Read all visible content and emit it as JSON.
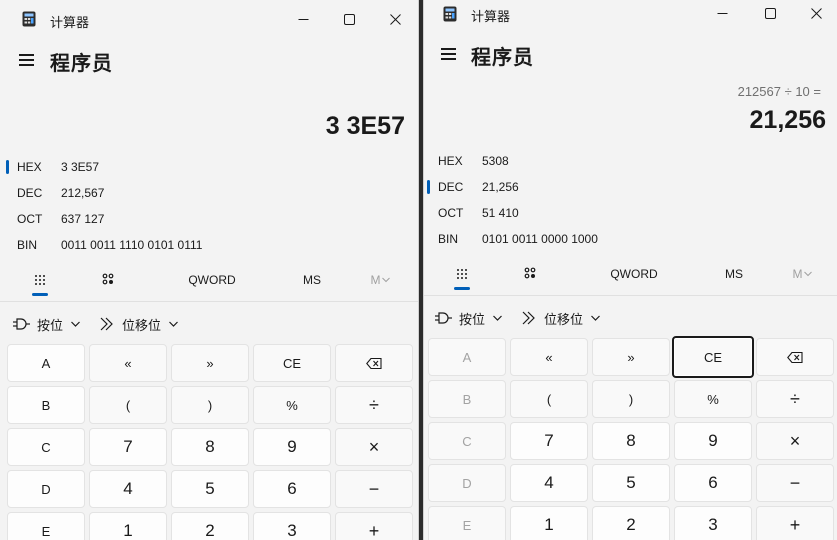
{
  "left": {
    "app_title": "计算器",
    "mode_title": "程序员",
    "display": "3 3E57",
    "radix": [
      {
        "label": "HEX",
        "value": "3 3E57"
      },
      {
        "label": "DEC",
        "value": "212,567"
      },
      {
        "label": "OCT",
        "value": "637 127"
      },
      {
        "label": "BIN",
        "value": "0011 0011 1110 0101 0111"
      }
    ],
    "tabs": {
      "word": "QWORD",
      "ms": "MS",
      "mplus": "M"
    },
    "options": {
      "bitwise": "按位",
      "bitshift": "位移位"
    },
    "keys": [
      [
        "A",
        "«",
        "»",
        "CE",
        "⌫"
      ],
      [
        "B",
        "(",
        ")",
        "%",
        "÷"
      ],
      [
        "C",
        "7",
        "8",
        "9",
        "×"
      ],
      [
        "D",
        "4",
        "5",
        "6",
        "−"
      ],
      [
        "E",
        "1",
        "2",
        "3",
        "+"
      ]
    ]
  },
  "right": {
    "app_title": "计算器",
    "mode_title": "程序员",
    "expression": "212567 ÷ 10 =",
    "display": "21,256",
    "radix": [
      {
        "label": "HEX",
        "value": "5308"
      },
      {
        "label": "DEC",
        "value": "21,256"
      },
      {
        "label": "OCT",
        "value": "51 410"
      },
      {
        "label": "BIN",
        "value": "0101 0011 0000 1000"
      }
    ],
    "tabs": {
      "word": "QWORD",
      "ms": "MS",
      "mplus": "M"
    },
    "options": {
      "bitwise": "按位",
      "bitshift": "位移位"
    },
    "keys": [
      [
        "A",
        "«",
        "»",
        "CE",
        "⌫"
      ],
      [
        "B",
        "(",
        ")",
        "%",
        "÷"
      ],
      [
        "C",
        "7",
        "8",
        "9",
        "×"
      ],
      [
        "D",
        "4",
        "5",
        "6",
        "−"
      ],
      [
        "E",
        "1",
        "2",
        "3",
        "+"
      ]
    ]
  },
  "colors": {
    "accent": "#005fb8",
    "window_bg": "#f3f3f3",
    "key_bg": "#fdfdfd",
    "disabled_text": "#a3a3a3"
  }
}
